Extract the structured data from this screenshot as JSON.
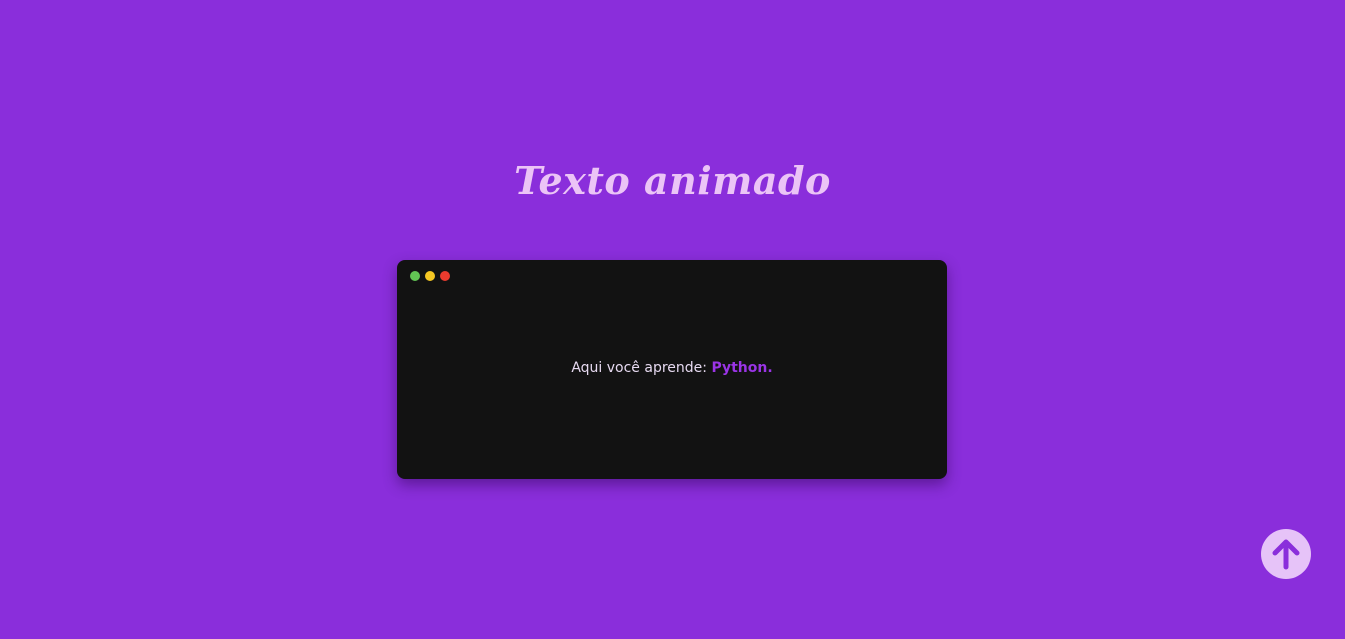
{
  "page": {
    "title": "Texto animado"
  },
  "terminal": {
    "window_dots": [
      "green",
      "yellow",
      "red"
    ],
    "prefix": "Aqui você aprende: ",
    "highlight": "Python."
  },
  "scroll_top_button": {
    "icon": "arrow-up-icon"
  },
  "colors": {
    "background": "#8a2edb",
    "title": "#ebc4f6",
    "terminal_background": "#121212",
    "highlight": "#9a34e6",
    "button_background": "#e6c3f8",
    "dot_green": "#62c554",
    "dot_yellow": "#f5c723",
    "dot_red": "#ea3b2e"
  }
}
